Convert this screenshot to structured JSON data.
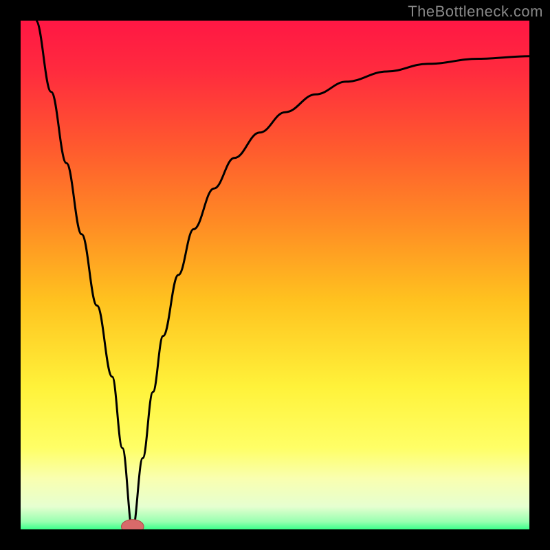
{
  "watermark": "TheBottleneck.com",
  "colors": {
    "frame": "#000000",
    "curve": "#000000",
    "marker_fill": "#d86a6a",
    "marker_stroke": "#b24646",
    "gradient_stops": [
      {
        "offset": 0.0,
        "color": "#ff1744"
      },
      {
        "offset": 0.1,
        "color": "#ff2b3e"
      },
      {
        "offset": 0.25,
        "color": "#ff5a2e"
      },
      {
        "offset": 0.4,
        "color": "#ff8c24"
      },
      {
        "offset": 0.55,
        "color": "#ffc21f"
      },
      {
        "offset": 0.72,
        "color": "#fff23a"
      },
      {
        "offset": 0.84,
        "color": "#ffff66"
      },
      {
        "offset": 0.9,
        "color": "#f9ffb0"
      },
      {
        "offset": 0.955,
        "color": "#e6ffd0"
      },
      {
        "offset": 0.985,
        "color": "#97ffb0"
      },
      {
        "offset": 1.0,
        "color": "#3bff8a"
      }
    ]
  },
  "chart_data": {
    "type": "line",
    "title": "",
    "xlabel": "",
    "ylabel": "",
    "xlim": [
      0,
      100
    ],
    "ylim": [
      0,
      100
    ],
    "marker": {
      "x": 22,
      "y": 0,
      "rx": 2.2,
      "ry": 1.0
    },
    "series": [
      {
        "name": "bottleneck-curve",
        "x": [
          3,
          6,
          9,
          12,
          15,
          18,
          20,
          22,
          24,
          26,
          28,
          31,
          34,
          38,
          42,
          47,
          52,
          58,
          64,
          72,
          80,
          90,
          100
        ],
        "y": [
          100,
          86,
          72,
          58,
          44,
          30,
          16,
          0,
          14,
          27,
          38,
          50,
          59,
          67,
          73,
          78,
          82,
          85.5,
          88,
          90,
          91.5,
          92.5,
          93
        ]
      }
    ]
  }
}
